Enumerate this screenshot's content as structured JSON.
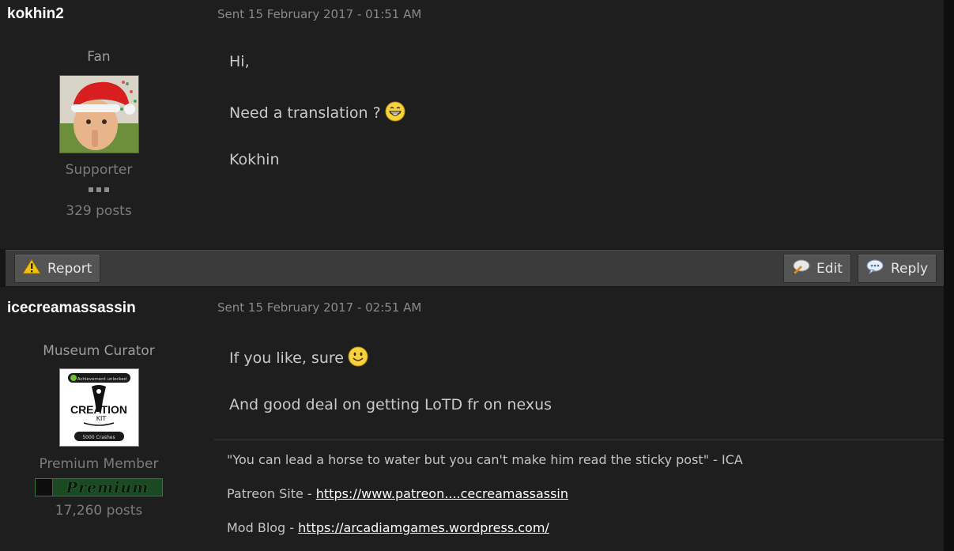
{
  "posts": [
    {
      "author": "kokhin2",
      "date": "Sent 15 February 2017 - 01:51 AM",
      "rank": "Fan",
      "group": "Supporter",
      "post_count": "329 posts",
      "avatar": "santa-hat-baby",
      "lines": [
        "Hi,",
        "Need a translation ?",
        "Kokhin"
      ],
      "emoji": "grin-emoji"
    },
    {
      "author": "icecreamassassin",
      "date": "Sent 15 February 2017 - 02:51 AM",
      "rank": "Museum Curator",
      "group": "Premium Member",
      "badge": "Premium",
      "post_count": "17,260 posts",
      "avatar": "creation-kit-achievement",
      "avatar_text": {
        "top": "Achievement unlocked",
        "title": "CREATION",
        "sub": "KIT",
        "bottom": "5000 Crashes"
      },
      "lines": [
        "If you like, sure",
        "And good deal on getting LoTD fr on nexus"
      ],
      "emoji": "smile-emoji",
      "signature": {
        "quote": "\"You can lead a horse to water but you can't make him read the sticky post\" - ICA",
        "patreon_label": "Patreon Site -",
        "patreon_link": "https://www.patreon....cecreamassassin",
        "blog_label": "Mod Blog -",
        "blog_link": "https://arcadiamgames.wordpress.com/"
      }
    }
  ],
  "actions": {
    "report": "Report",
    "edit": "Edit",
    "reply": "Reply"
  }
}
